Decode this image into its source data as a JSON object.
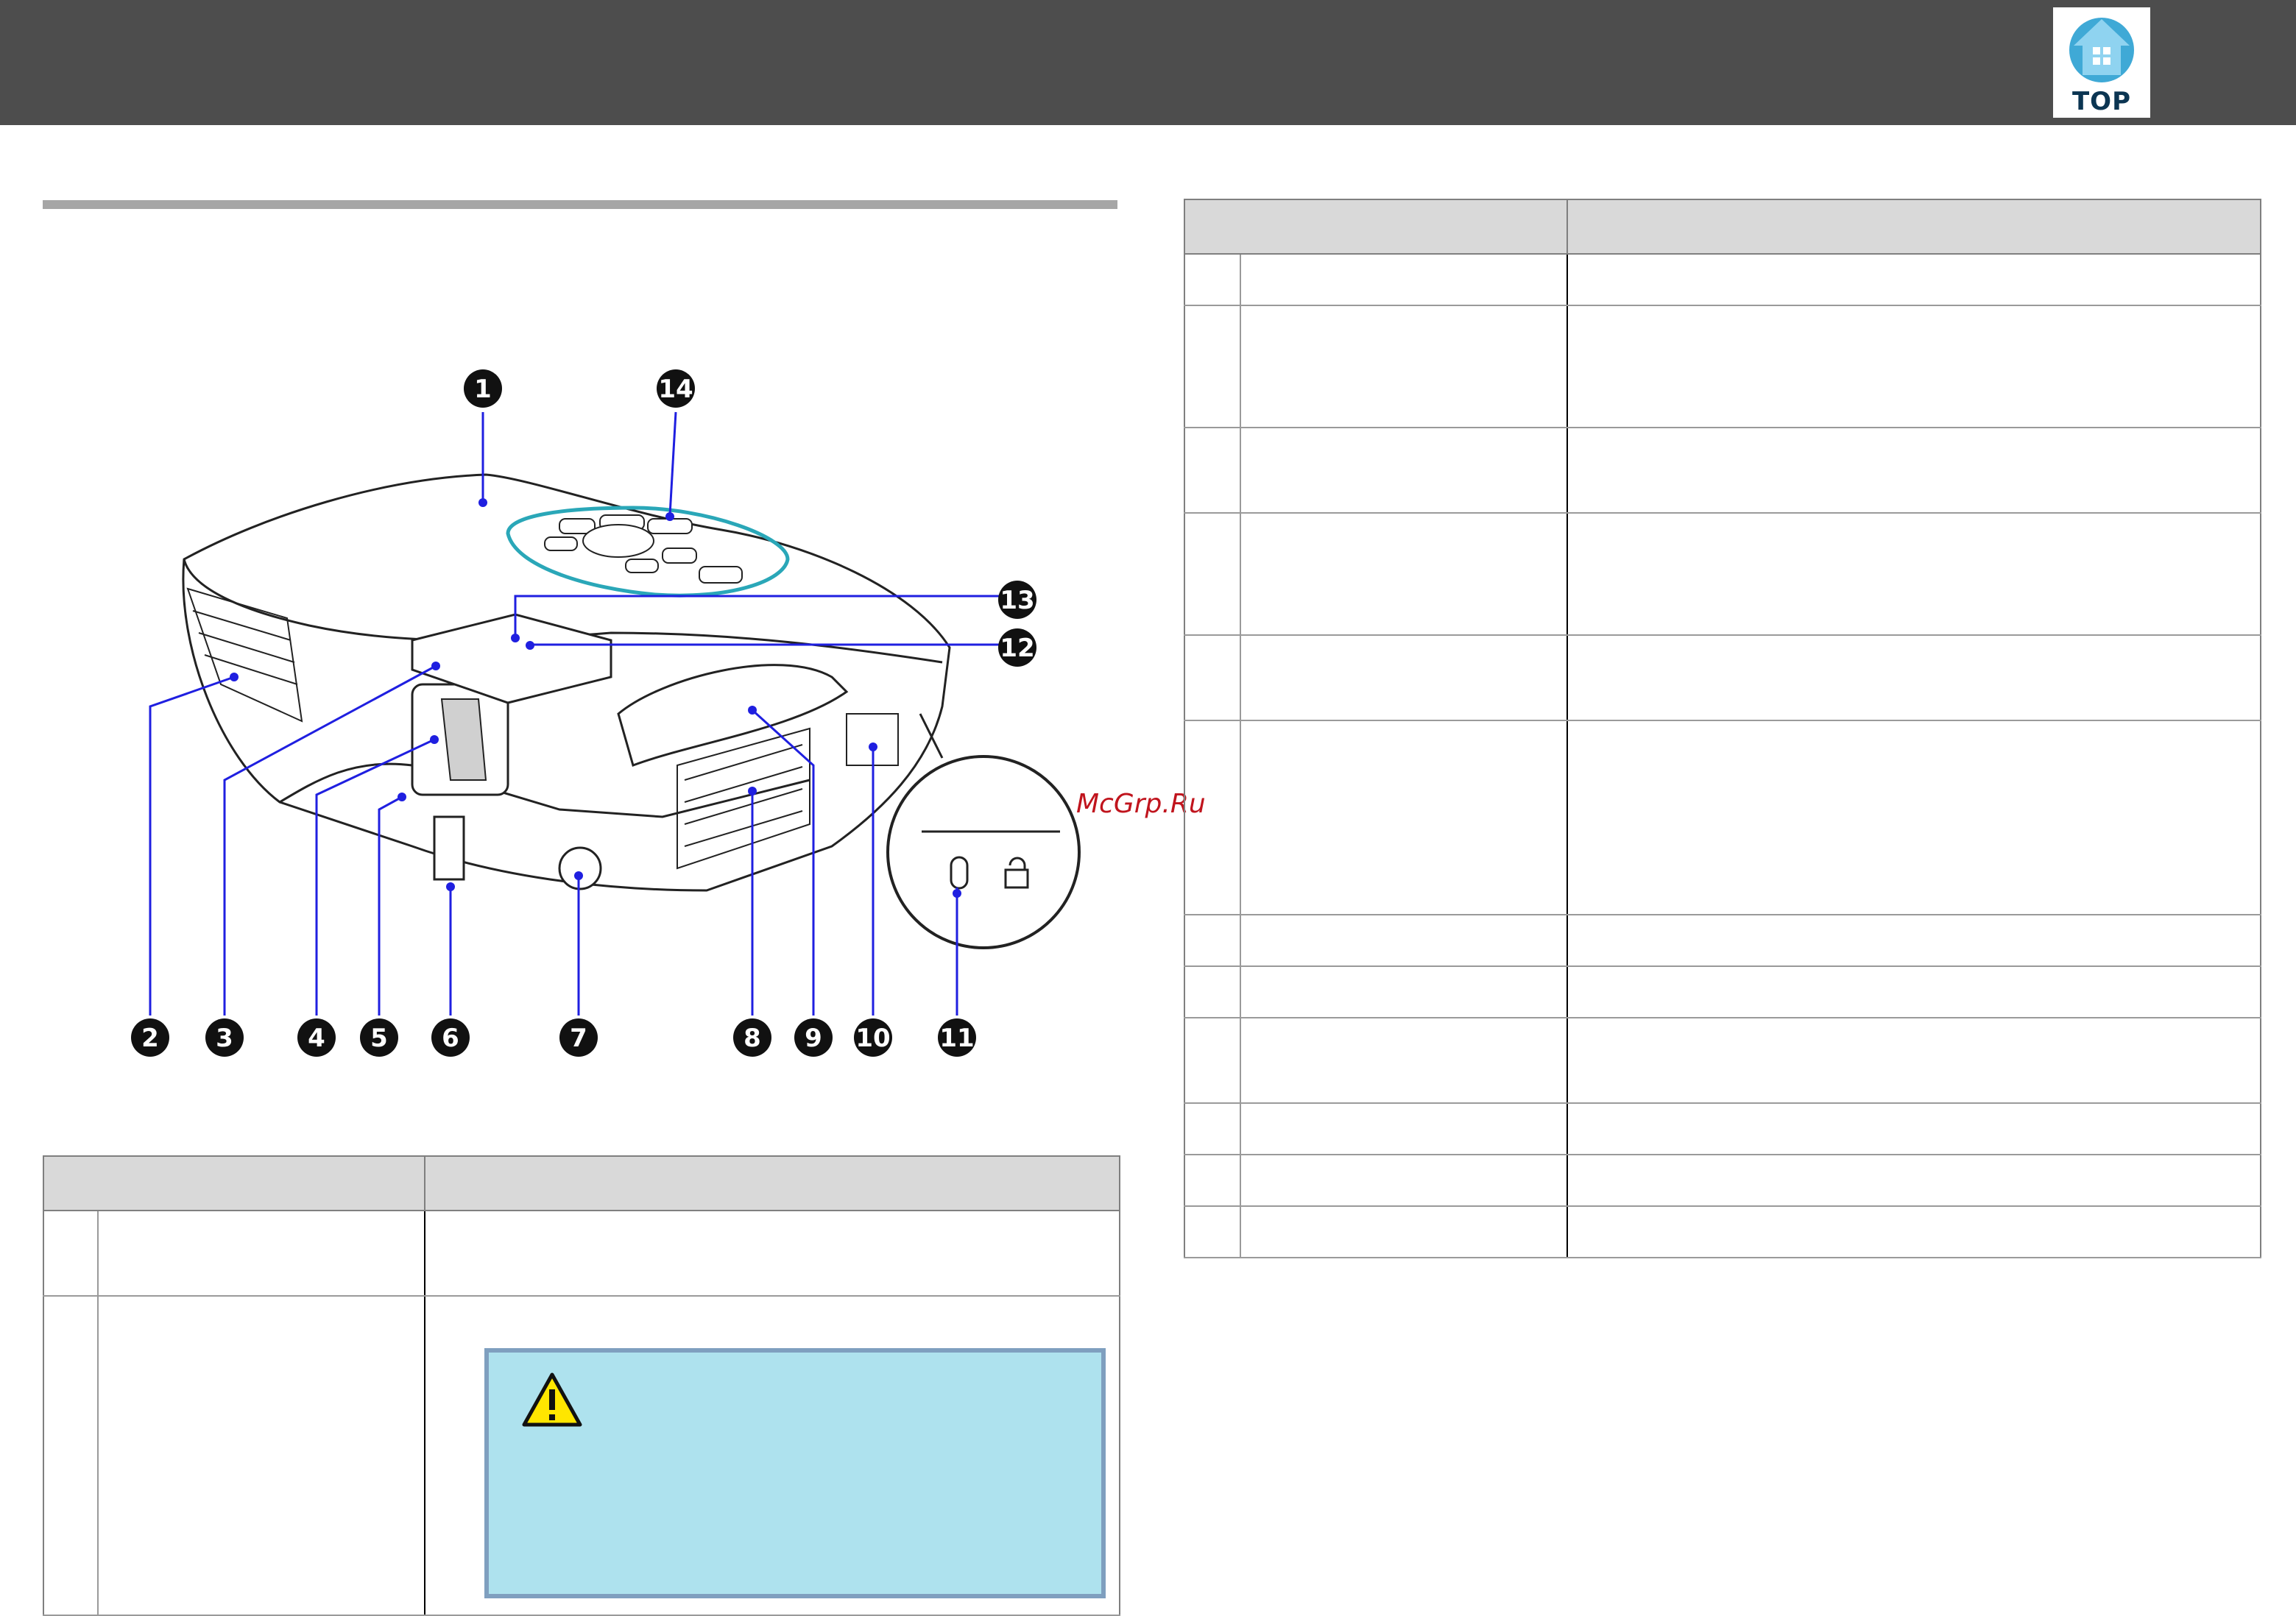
{
  "header": {
    "top_button_label": "TOP",
    "top_icon": "house-up-arrow-icon",
    "bar_color": "#4d4d4d",
    "icon_color": "#3fa9d6"
  },
  "watermark": {
    "text": "McGrp.Ru",
    "color": "#c0141d"
  },
  "diagram": {
    "subject": "projector-front-view",
    "callouts": [
      {
        "label": "1"
      },
      {
        "label": "2"
      },
      {
        "label": "3"
      },
      {
        "label": "4"
      },
      {
        "label": "5"
      },
      {
        "label": "6"
      },
      {
        "label": "7"
      },
      {
        "label": "8"
      },
      {
        "label": "9"
      },
      {
        "label": "10"
      },
      {
        "label": "11"
      },
      {
        "label": "12"
      },
      {
        "label": "13"
      },
      {
        "label": "14"
      }
    ],
    "leader_color": "#1f1fe0"
  },
  "left_table": {
    "header_fill": "#d9d9d9",
    "row_count": 2
  },
  "caution_box": {
    "icon": "warning-triangle-icon",
    "fill": "#aee2ee",
    "border_color": "#7f9fbf"
  },
  "right_table": {
    "header_fill": "#d9d9d9",
    "row_count": 12
  }
}
